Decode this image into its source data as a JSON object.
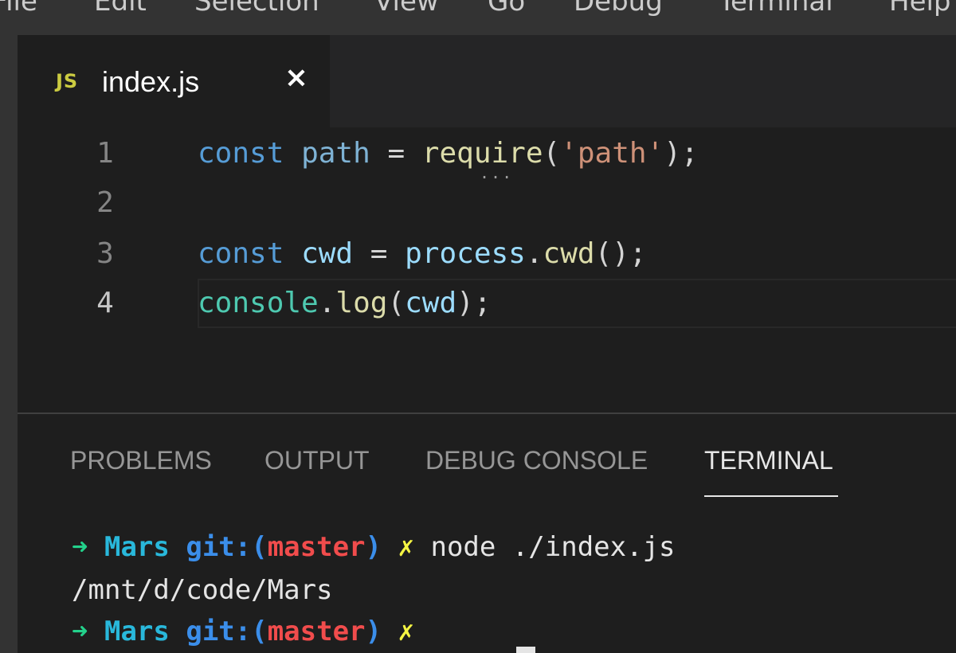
{
  "menu": {
    "items": [
      "File",
      "Edit",
      "Selection",
      "View",
      "Go",
      "Debug",
      "Terminal",
      "Help"
    ]
  },
  "tab": {
    "icon_text": "JS",
    "icon": "js-file-icon",
    "label": "index.js",
    "close_glyph": "×"
  },
  "editor": {
    "lines": [
      {
        "number": "1",
        "tokens": [
          "const",
          " ",
          "path",
          " = ",
          "require",
          "(",
          "'path'",
          ");"
        ]
      },
      {
        "number": "2",
        "tokens": []
      },
      {
        "number": "3",
        "tokens": [
          "const",
          " ",
          "cwd",
          " = ",
          "process",
          ".",
          "cwd",
          "();"
        ]
      },
      {
        "number": "4",
        "tokens": [
          "console",
          ".",
          "log",
          "(",
          "cwd",
          ");"
        ]
      }
    ],
    "active_line": "4",
    "hint_glyph": "..."
  },
  "panel": {
    "tabs": [
      "PROBLEMS",
      "OUTPUT",
      "DEBUG CONSOLE",
      "TERMINAL"
    ],
    "active_tab": "TERMINAL"
  },
  "terminal": {
    "prompt_arrow": "➜",
    "prompt_dir": "Mars",
    "git_prefix": "git:(",
    "git_branch": "master",
    "git_suffix": ")",
    "dirty_mark": "✗",
    "command": "node ./index.js",
    "output": "/mnt/d/code/Mars"
  },
  "colors": {
    "background": "#1e1e1e",
    "keyword": "#569cd6",
    "string": "#ce9178",
    "function": "#dcdcaa",
    "class": "#4ec9b0",
    "prompt_arrow": "#23d18b",
    "branch": "#f14c4c",
    "dirty_mark": "#f5f543"
  }
}
